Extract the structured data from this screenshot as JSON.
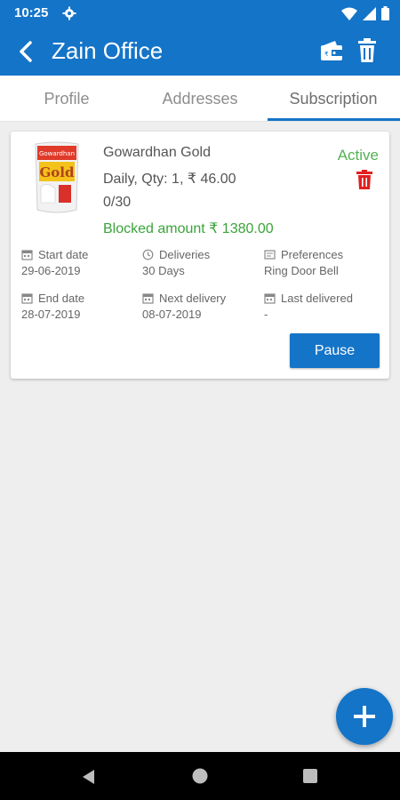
{
  "status_bar": {
    "time": "10:25"
  },
  "app_bar": {
    "title": "Zain Office"
  },
  "tabs": [
    {
      "label": "Profile"
    },
    {
      "label": "Addresses"
    },
    {
      "label": "Subscription"
    }
  ],
  "subscription": {
    "product_name": "Gowardhan Gold",
    "product_image_text": {
      "brand": "Gowardhan",
      "variant": "Gold"
    },
    "info": "Daily, Qty: 1, ₹ 46.00",
    "progress": "0/30",
    "blocked_amount": "Blocked amount ₹ 1380.00",
    "status": "Active",
    "details": {
      "start_date": {
        "label": "Start date",
        "value": "29-06-2019"
      },
      "deliveries": {
        "label": "Deliveries",
        "value": "30 Days"
      },
      "preferences": {
        "label": "Preferences",
        "value": "Ring Door Bell"
      },
      "end_date": {
        "label": "End date",
        "value": "28-07-2019"
      },
      "next_delivery": {
        "label": "Next delivery",
        "value": "08-07-2019"
      },
      "last_delivered": {
        "label": "Last delivered",
        "value": "-"
      }
    },
    "pause_label": "Pause"
  },
  "colors": {
    "primary": "#1474c8",
    "active_green": "#55b155",
    "blocked_green": "#3aa43a",
    "delete_red": "#e02020"
  }
}
